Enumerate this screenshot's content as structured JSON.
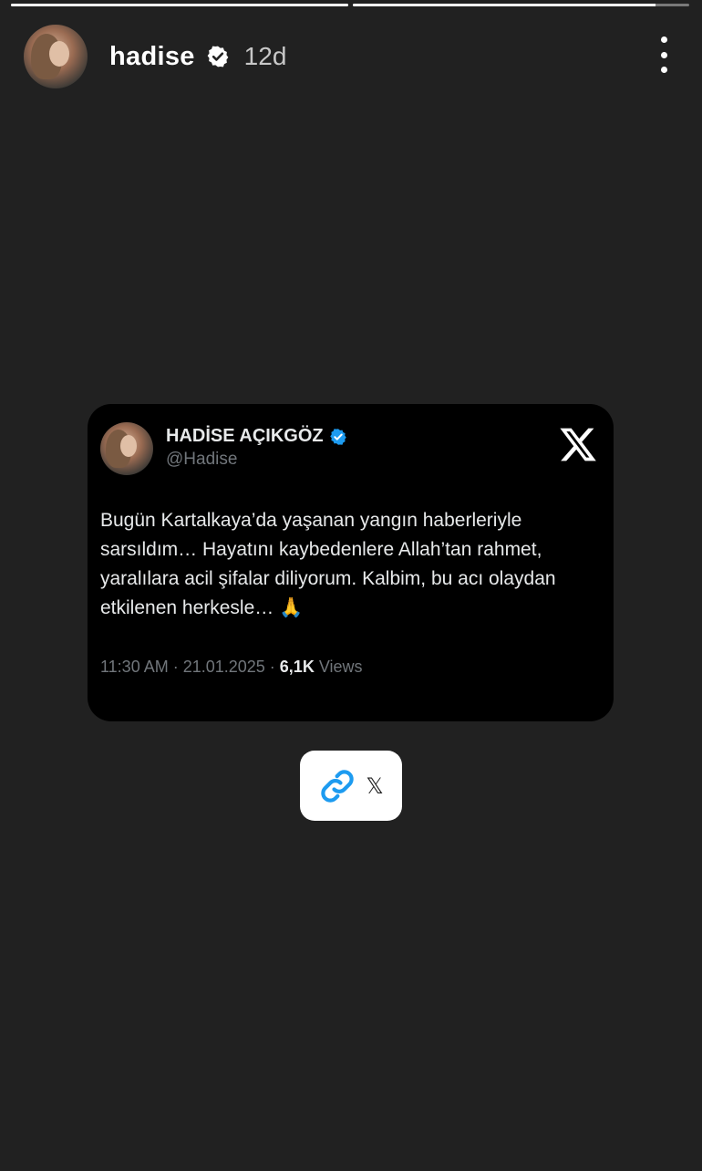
{
  "story": {
    "progress": [
      1.0,
      0.9
    ]
  },
  "header": {
    "username": "hadise",
    "timestamp": "12d",
    "verified_icon": "verified-badge-icon",
    "menu_icon": "more-vertical-icon"
  },
  "tweet": {
    "name": "HADİSE AÇIKGÖZ",
    "handle": "@Hadise",
    "body": "Bugün Kartalkaya’da yaşanan yangın haberleriyle sarsıldım… Hayatını kaybedenlere Allah’tan rahmet, yaralılara acil şifalar diliyorum. Kalbim, bu acı olaydan etkilenen herkesle… 🙏",
    "time_date": "11:30 AM · 21.01.2025 · ",
    "views_count": "6,1K",
    "views_label": " Views",
    "logo_icon": "x-logo-icon",
    "accent_color": "#1d9bf0"
  },
  "link_sticker": {
    "label": "𝕏",
    "icon": "link-icon",
    "icon_color": "#1d9bf0"
  }
}
